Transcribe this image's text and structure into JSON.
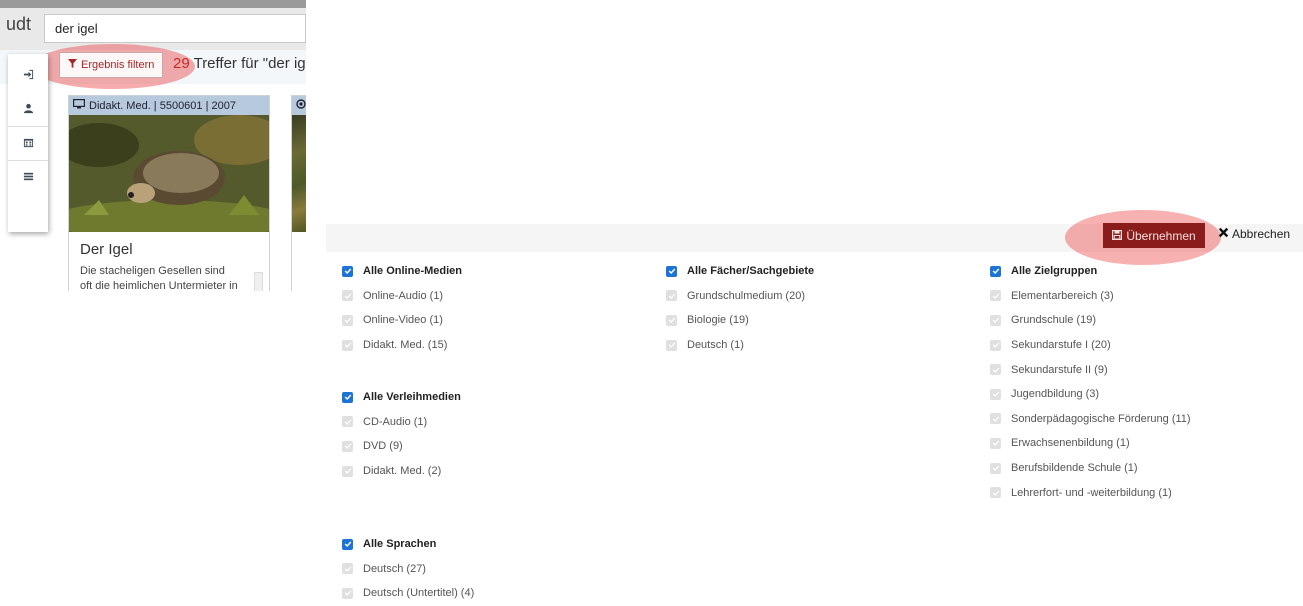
{
  "header": {
    "brand_fragment": "udt",
    "search_value": "der igel"
  },
  "toolbar": {
    "filter_button_label": "Ergebnis filtern",
    "result_count": "29",
    "result_text": " Treffer für \"der ige"
  },
  "side_menu": {
    "icons": [
      "sign-in-icon",
      "user-icon",
      "calendar-icon",
      "list-icon"
    ]
  },
  "cards": [
    {
      "meta": "Didakt. Med. | 5500601 | 2007",
      "title": "Der Igel",
      "text": "Die stacheligen Gesellen sind oft die heimlichen Untermieter in unseren"
    },
    {
      "meta": ""
    }
  ],
  "filter_panel": {
    "apply_label": "Übernehmen",
    "cancel_label": "Abbrechen",
    "groups": [
      {
        "heading": "Alle Online-Medien",
        "items": [
          "Online-Audio (1)",
          "Online-Video (1)",
          "Didakt. Med. (15)"
        ]
      },
      {
        "heading": "Alle Verleihmedien",
        "items": [
          "CD-Audio (1)",
          "DVD (9)",
          "Didakt. Med. (2)"
        ]
      },
      {
        "heading": "Alle Sprachen",
        "items": [
          "Deutsch (27)",
          "Deutsch (Untertitel) (4)"
        ]
      },
      {
        "heading": "Alle Fächer/Sachgebiete",
        "items": [
          "Grundschulmedium (20)",
          "Biologie (19)",
          "Deutsch (1)"
        ]
      },
      {
        "heading": "Alle Zielgruppen",
        "items": [
          "Elementarbereich (3)",
          "Grundschule (19)",
          "Sekundarstufe I (20)",
          "Sekundarstufe II (9)",
          "Jugendbildung (3)",
          "Sonderpädagogische Förderung (11)",
          "Erwachsenenbildung (1)",
          "Berufsbildende Schule (1)",
          "Lehrerfort- und -weiterbildung (1)"
        ]
      }
    ]
  },
  "colors": {
    "accent_red": "#8b1c1c",
    "checkbox_blue": "#1c74d4",
    "card_header": "#b7c9dd"
  }
}
